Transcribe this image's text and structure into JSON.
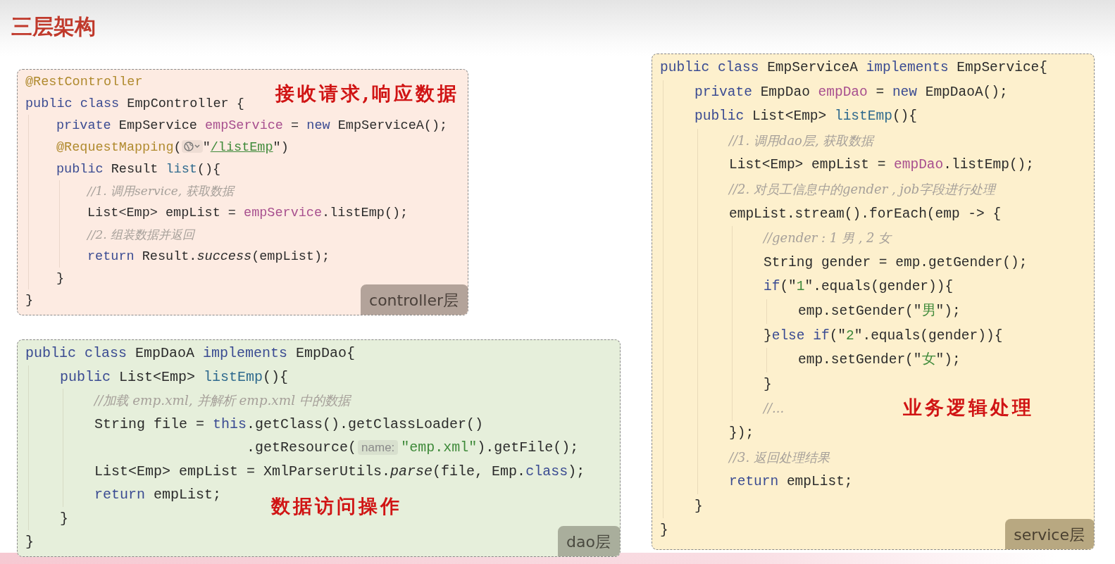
{
  "title": "三层架构",
  "left_column": [
    {
      "kind": "controller",
      "tag": "controller层",
      "note": "接收请求,响应数据",
      "lines": [
        {
          "tokens": [
            {
              "kind": "annotation",
              "text": "@RestController"
            }
          ]
        },
        {
          "tokens": [
            {
              "kind": "keyword",
              "text": "public class "
            },
            {
              "kind": "plain",
              "text": "EmpController {"
            }
          ],
          "children": [
            {
              "tokens": [
                {
                  "kind": "keyword",
                  "text": "private "
                },
                {
                  "kind": "plain",
                  "text": "EmpService "
                },
                {
                  "kind": "field",
                  "text": "empService"
                },
                {
                  "kind": "plain",
                  "text": " = "
                },
                {
                  "kind": "keyword",
                  "text": "new "
                },
                {
                  "kind": "plain",
                  "text": "EmpServiceA();"
                }
              ]
            },
            {
              "tokens": [
                {
                  "kind": "annotation",
                  "text": "@RequestMapping"
                },
                {
                  "kind": "plain",
                  "text": "("
                },
                {
                  "kind": "globe"
                },
                {
                  "kind": "plain",
                  "text": "\""
                },
                {
                  "kind": "link",
                  "text": "/listEmp"
                },
                {
                  "kind": "plain",
                  "text": "\")"
                }
              ]
            },
            {
              "tokens": [
                {
                  "kind": "keyword",
                  "text": "public "
                },
                {
                  "kind": "plain",
                  "text": "Result "
                },
                {
                  "kind": "method",
                  "text": "list"
                },
                {
                  "kind": "plain",
                  "text": "(){"
                }
              ],
              "children": [
                {
                  "tokens": [
                    {
                      "kind": "comment",
                      "text": "//1. 调用service, 获取数据"
                    }
                  ]
                },
                {
                  "tokens": [
                    {
                      "kind": "plain",
                      "text": "List<Emp> empList = "
                    },
                    {
                      "kind": "field",
                      "text": "empService"
                    },
                    {
                      "kind": "plain",
                      "text": ".listEmp();"
                    }
                  ]
                },
                {
                  "tokens": [
                    {
                      "kind": "comment",
                      "text": "//2. 组装数据并返回"
                    }
                  ]
                },
                {
                  "tokens": [
                    {
                      "kind": "keyword",
                      "text": "return "
                    },
                    {
                      "kind": "plain",
                      "text": "Result."
                    },
                    {
                      "kind": "italic",
                      "text": "success"
                    },
                    {
                      "kind": "plain",
                      "text": "(empList);"
                    }
                  ]
                }
              ]
            },
            {
              "tokens": [
                {
                  "kind": "plain",
                  "text": "}"
                }
              ]
            }
          ]
        },
        {
          "tokens": [
            {
              "kind": "plain",
              "text": "}"
            }
          ]
        }
      ]
    },
    {
      "kind": "dao",
      "tag": "dao层",
      "note": "数据访问操作",
      "lines": [
        {
          "tokens": [
            {
              "kind": "keyword",
              "text": "public class "
            },
            {
              "kind": "plain",
              "text": "EmpDaoA "
            },
            {
              "kind": "keyword",
              "text": "implements "
            },
            {
              "kind": "plain",
              "text": "EmpDao{"
            }
          ],
          "children": [
            {
              "tokens": [
                {
                  "kind": "keyword",
                  "text": "public "
                },
                {
                  "kind": "plain",
                  "text": "List<Emp> "
                },
                {
                  "kind": "method",
                  "text": "listEmp"
                },
                {
                  "kind": "plain",
                  "text": "(){"
                }
              ],
              "children": [
                {
                  "tokens": [
                    {
                      "kind": "comment",
                      "text": "//加载 emp.xml, 并解析 emp.xml 中的数据"
                    }
                  ]
                },
                {
                  "tokens": [
                    {
                      "kind": "plain",
                      "text": "String file = "
                    },
                    {
                      "kind": "keyword",
                      "text": "this"
                    },
                    {
                      "kind": "plain",
                      "text": ".getClass().getClassLoader()"
                    }
                  ]
                },
                {
                  "tokens": [
                    {
                      "kind": "plain",
                      "text": "                  .getResource("
                    },
                    {
                      "kind": "hint",
                      "text": "name:"
                    },
                    {
                      "kind": "string",
                      "text": "\"emp.xml\""
                    },
                    {
                      "kind": "plain",
                      "text": ").getFile();"
                    }
                  ]
                },
                {
                  "tokens": [
                    {
                      "kind": "plain",
                      "text": "List<Emp> empList = XmlParserUtils."
                    },
                    {
                      "kind": "italic",
                      "text": "parse"
                    },
                    {
                      "kind": "plain",
                      "text": "(file, Emp."
                    },
                    {
                      "kind": "keyword",
                      "text": "class"
                    },
                    {
                      "kind": "plain",
                      "text": ");"
                    }
                  ]
                },
                {
                  "tokens": [
                    {
                      "kind": "keyword",
                      "text": "return "
                    },
                    {
                      "kind": "plain",
                      "text": "empList;"
                    }
                  ]
                }
              ]
            },
            {
              "tokens": [
                {
                  "kind": "plain",
                  "text": "}"
                }
              ]
            }
          ]
        },
        {
          "tokens": [
            {
              "kind": "plain",
              "text": "}"
            }
          ]
        }
      ]
    }
  ],
  "right_column": [
    {
      "kind": "service",
      "tag": "service层",
      "note": "业务逻辑处理",
      "lines": [
        {
          "tokens": [
            {
              "kind": "keyword",
              "text": "public class "
            },
            {
              "kind": "plain",
              "text": "EmpServiceA "
            },
            {
              "kind": "keyword",
              "text": "implements "
            },
            {
              "kind": "plain",
              "text": "EmpService{"
            }
          ],
          "children": [
            {
              "tokens": [
                {
                  "kind": "keyword",
                  "text": "private "
                },
                {
                  "kind": "plain",
                  "text": "EmpDao "
                },
                {
                  "kind": "field",
                  "text": "empDao"
                },
                {
                  "kind": "plain",
                  "text": " = "
                },
                {
                  "kind": "keyword",
                  "text": "new "
                },
                {
                  "kind": "plain",
                  "text": "EmpDaoA();"
                }
              ]
            },
            {
              "tokens": [
                {
                  "kind": "keyword",
                  "text": "public "
                },
                {
                  "kind": "plain",
                  "text": "List<Emp> "
                },
                {
                  "kind": "method",
                  "text": "listEmp"
                },
                {
                  "kind": "plain",
                  "text": "(){"
                }
              ],
              "children": [
                {
                  "tokens": [
                    {
                      "kind": "comment",
                      "text": "//1. 调用dao层, 获取数据"
                    }
                  ]
                },
                {
                  "tokens": [
                    {
                      "kind": "plain",
                      "text": "List<Emp> empList = "
                    },
                    {
                      "kind": "field",
                      "text": "empDao"
                    },
                    {
                      "kind": "plain",
                      "text": ".listEmp();"
                    }
                  ]
                },
                {
                  "tokens": [
                    {
                      "kind": "comment",
                      "text": "//2. 对员工信息中的gender , job字段进行处理"
                    }
                  ]
                },
                {
                  "tokens": [
                    {
                      "kind": "plain",
                      "text": "empList.stream().forEach(emp -> {"
                    }
                  ],
                  "children": [
                    {
                      "tokens": [
                        {
                          "kind": "comment",
                          "text": "//gender : 1 男 , 2 女"
                        }
                      ]
                    },
                    {
                      "tokens": [
                        {
                          "kind": "plain",
                          "text": "String gender = emp.getGender();"
                        }
                      ]
                    },
                    {
                      "tokens": [
                        {
                          "kind": "keyword",
                          "text": "if"
                        },
                        {
                          "kind": "plain",
                          "text": "(\""
                        },
                        {
                          "kind": "string",
                          "text": "1"
                        },
                        {
                          "kind": "plain",
                          "text": "\".equals(gender)){"
                        }
                      ],
                      "children": [
                        {
                          "tokens": [
                            {
                              "kind": "plain",
                              "text": "emp.setGender(\""
                            },
                            {
                              "kind": "string",
                              "text": "男"
                            },
                            {
                              "kind": "plain",
                              "text": "\");"
                            }
                          ]
                        }
                      ]
                    },
                    {
                      "tokens": [
                        {
                          "kind": "plain",
                          "text": "}"
                        },
                        {
                          "kind": "keyword",
                          "text": "else if"
                        },
                        {
                          "kind": "plain",
                          "text": "(\""
                        },
                        {
                          "kind": "string",
                          "text": "2"
                        },
                        {
                          "kind": "plain",
                          "text": "\".equals(gender)){"
                        }
                      ],
                      "children": [
                        {
                          "tokens": [
                            {
                              "kind": "plain",
                              "text": "emp.setGender(\""
                            },
                            {
                              "kind": "string",
                              "text": "女"
                            },
                            {
                              "kind": "plain",
                              "text": "\");"
                            }
                          ]
                        }
                      ]
                    },
                    {
                      "tokens": [
                        {
                          "kind": "plain",
                          "text": "}"
                        }
                      ]
                    },
                    {
                      "tokens": [
                        {
                          "kind": "comment",
                          "text": "//..."
                        }
                      ]
                    }
                  ]
                },
                {
                  "tokens": [
                    {
                      "kind": "plain",
                      "text": "});"
                    }
                  ]
                },
                {
                  "tokens": [
                    {
                      "kind": "comment",
                      "text": "//3. 返回处理结果"
                    }
                  ]
                },
                {
                  "tokens": [
                    {
                      "kind": "keyword",
                      "text": "return "
                    },
                    {
                      "kind": "plain",
                      "text": "empList;"
                    }
                  ]
                }
              ]
            },
            {
              "tokens": [
                {
                  "kind": "plain",
                  "text": "}"
                }
              ]
            }
          ]
        },
        {
          "tokens": [
            {
              "kind": "plain",
              "text": "}"
            }
          ]
        }
      ]
    }
  ]
}
